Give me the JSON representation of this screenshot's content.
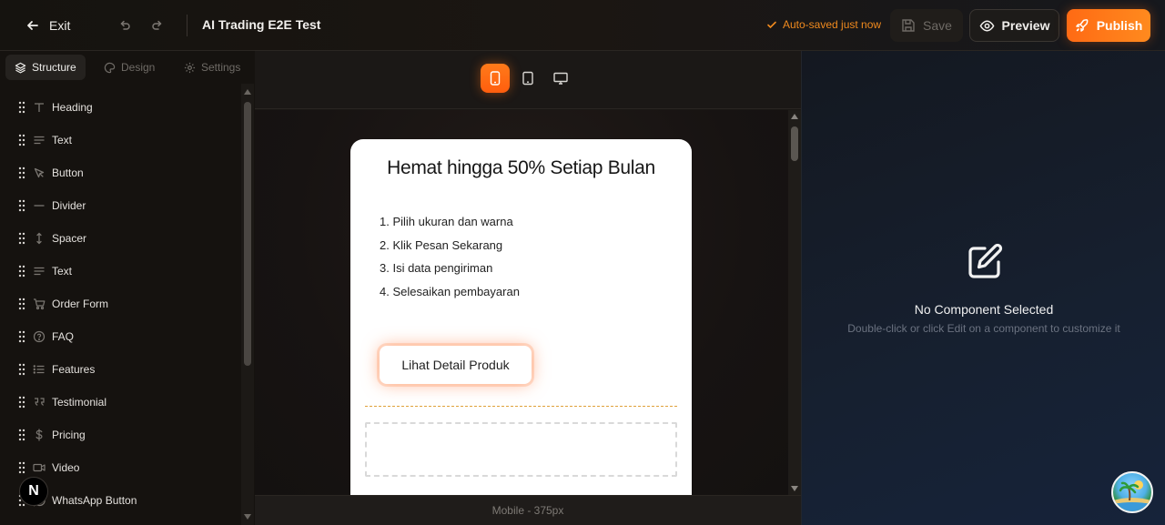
{
  "topbar": {
    "exit_label": "Exit",
    "title": "AI Trading E2E Test",
    "autosave": "Auto-saved just now",
    "save_label": "Save",
    "preview_label": "Preview",
    "publish_label": "Publish"
  },
  "sidebar": {
    "tabs": [
      {
        "label": "Structure",
        "icon": "layers-icon",
        "active": true
      },
      {
        "label": "Design",
        "icon": "palette-icon",
        "active": false
      },
      {
        "label": "Settings",
        "icon": "gear-icon",
        "active": false
      }
    ],
    "items": [
      {
        "label": "Heading",
        "icon": "heading-icon"
      },
      {
        "label": "Text",
        "icon": "text-icon"
      },
      {
        "label": "Button",
        "icon": "cursor-icon"
      },
      {
        "label": "Divider",
        "icon": "divider-icon"
      },
      {
        "label": "Spacer",
        "icon": "spacer-icon"
      },
      {
        "label": "Text",
        "icon": "text-icon"
      },
      {
        "label": "Order Form",
        "icon": "cart-icon"
      },
      {
        "label": "FAQ",
        "icon": "help-circle-icon"
      },
      {
        "label": "Features",
        "icon": "list-icon"
      },
      {
        "label": "Testimonial",
        "icon": "quote-icon"
      },
      {
        "label": "Pricing",
        "icon": "dollar-icon"
      },
      {
        "label": "Video",
        "icon": "video-icon"
      },
      {
        "label": "WhatsApp Button",
        "icon": "whatsapp-icon"
      }
    ],
    "badge": "N"
  },
  "canvas": {
    "device_mode": "mobile",
    "footer_label": "Mobile - 375px",
    "page": {
      "heading": "Hemat hingga 50% Setiap Bulan",
      "steps": [
        "1. Pilih ukuran dan warna",
        "2. Klik Pesan Sekarang",
        "3. Isi data pengiriman",
        "4. Selesaikan pembayaran"
      ],
      "cta_label": "Lihat Detail Produk"
    }
  },
  "right_panel": {
    "title": "No Component Selected",
    "subtitle": "Double-click or click Edit on a component to customize it"
  },
  "colors": {
    "accent": "#ff6a14",
    "autosave": "#f08a1e"
  }
}
